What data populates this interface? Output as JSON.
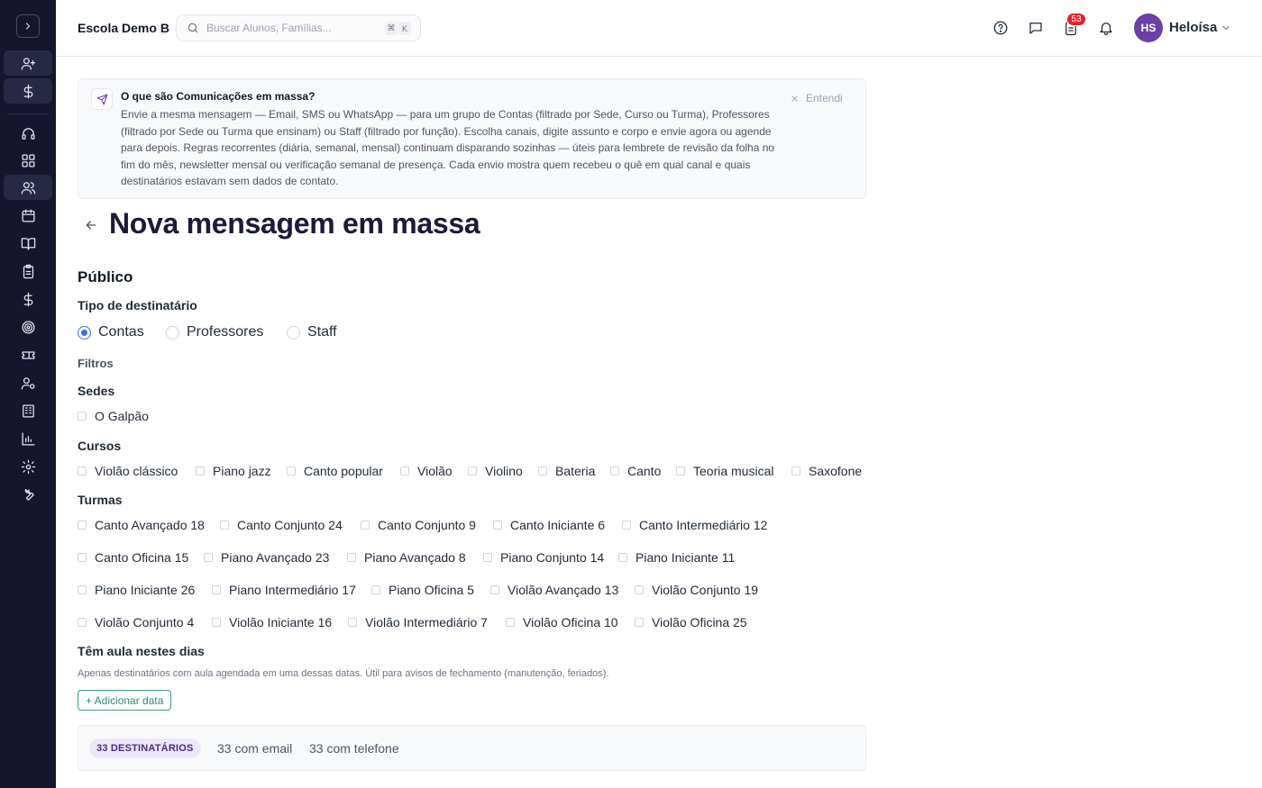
{
  "header": {
    "school_name": "Escola Demo B",
    "search_placeholder": "Buscar Alunos, Famílias...",
    "shortcut_key1": "⌘",
    "shortcut_key2": "K",
    "tasks_badge": "53",
    "avatar_initials": "HS",
    "user_name": "Heloísa"
  },
  "sidebar": {
    "icons": [
      "chevron-right-icon",
      "user-plus-icon",
      "dollar-icon",
      "headset-icon",
      "dashboard-icon",
      "users-icon",
      "calendar-icon",
      "book-icon",
      "clipboard-icon",
      "dollar-icon",
      "target-icon",
      "ticket-icon",
      "user-cog-icon",
      "building-icon",
      "bar-chart-icon",
      "gear-icon",
      "wrench-icon"
    ]
  },
  "info": {
    "title": "O que são Comunicações em massa?",
    "body": "Envie a mesma mensagem — Email, SMS ou WhatsApp — para um grupo de Contas (filtrado por Sede, Curso ou Turma), Professores (filtrado por Sede ou Turma que ensinam) ou Staff (filtrado por função). Escolha canais, digite assunto e corpo e envie agora ou agende para depois. Regras recorrentes (diária, semanal, mensal) continuam disparando sozinhas — úteis para lembrete de revisão da folha no fim do mês, newsletter mensal ou verificação semanal de presença. Cada envio mostra quem recebeu o quê em qual canal e quais destinatários estavam sem dados de contato.",
    "dismiss_label": "Entendi"
  },
  "page": {
    "title": "Nova mensagem em massa",
    "section_publico": "Público",
    "recipient_type_label": "Tipo de destinatário",
    "recipient_types": [
      "Contas",
      "Professores",
      "Staff"
    ],
    "recipient_type_selected": "Contas",
    "filters_label": "Filtros",
    "sedes_label": "Sedes",
    "sedes": [
      "O Galpão"
    ],
    "cursos_label": "Cursos",
    "cursos": [
      "Violão clássico",
      "Piano jazz",
      "Canto popular",
      "Violão",
      "Violino",
      "Bateria",
      "Canto",
      "Teoria musical",
      "Saxofone"
    ],
    "turmas_label": "Turmas",
    "turmas": [
      "Canto Avançado 18",
      "Canto Conjunto 24",
      "Canto Conjunto 9",
      "Canto Iniciante 6",
      "Canto Intermediário 12",
      "Canto Oficina 15",
      "Piano Avançado 23",
      "Piano Avançado 8",
      "Piano Conjunto 14",
      "Piano Iniciante 11",
      "Piano Iniciante 26",
      "Piano Intermediário 17",
      "Piano Oficina 5",
      "Violão Avançado 13",
      "Violão Conjunto 19",
      "Violão Conjunto 4",
      "Violão Iniciante 16",
      "Violão Intermediário 7",
      "Violão Oficina 10",
      "Violão Oficina 25"
    ],
    "days_label": "Têm aula nestes dias",
    "days_hint": "Apenas destinatários com aula agendada em uma dessas datas. Útil para avisos de fechamento (manutenção, feriados).",
    "add_date_label": "+ Adicionar data"
  },
  "summary": {
    "recipients_pill": "33 DESTINATÁRIOS",
    "with_email": "33 com email",
    "with_phone": "33 com telefone"
  },
  "colors": {
    "sidebar_bg": "#15162e",
    "accent_radio": "#3b6fd8",
    "avatar_bg": "#6d3fa9",
    "badge_red": "#dc2626",
    "add_date_green": "#2f8a74"
  }
}
